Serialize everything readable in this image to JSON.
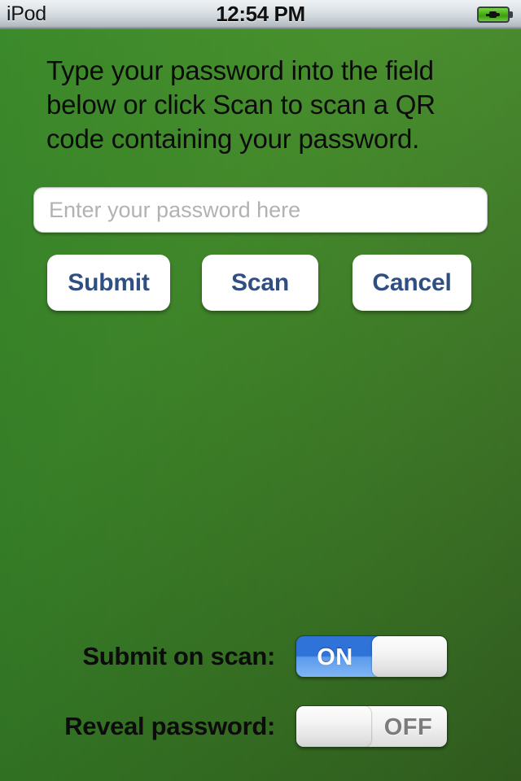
{
  "statusbar": {
    "carrier": "iPod",
    "time": "12:54 PM",
    "battery_icon": "battery-charging-icon",
    "battery_color": "#4cb319"
  },
  "main": {
    "instructions": "Type your password into the field below or click Scan to scan a QR code containing your password.",
    "password_input": {
      "value": "",
      "placeholder": "Enter your password here"
    },
    "buttons": {
      "submit": "Submit",
      "scan": "Scan",
      "cancel": "Cancel"
    },
    "button_text_color": "#2f4f82"
  },
  "settings": {
    "rows": [
      {
        "label": "Submit on scan:",
        "state": "ON",
        "on": true,
        "accent": "#2f72d8"
      },
      {
        "label": "Reveal password:",
        "state": "OFF",
        "on": false,
        "accent": "#7c7c7c"
      }
    ]
  },
  "theme": {
    "background_top_right": "#5aab39",
    "background_bottom_left": "#17410f"
  }
}
